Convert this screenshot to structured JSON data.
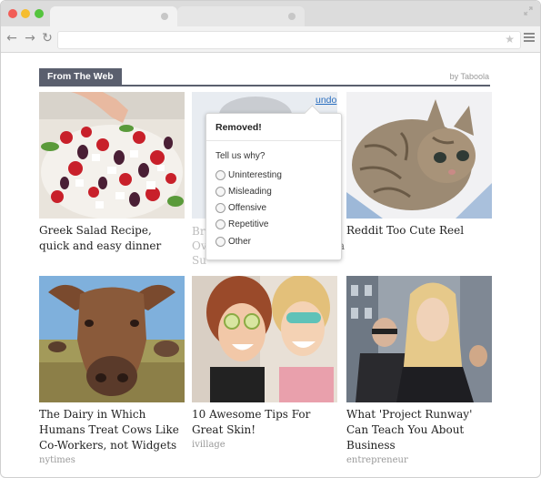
{
  "browser": {
    "url": "",
    "icons": {
      "back": "back-arrow-icon",
      "forward": "forward-arrow-icon",
      "reload": "reload-icon",
      "star": "star-icon",
      "menu": "hamburger-menu-icon",
      "expand": "expand-icon"
    }
  },
  "widget": {
    "header_label": "From The Web",
    "attribution": "by Taboola",
    "accent_color": "#5a5f6e"
  },
  "cards": [
    {
      "title": "Greek Salad Recipe, quick and easy dinner",
      "source": ""
    },
    {
      "title": "",
      "source": ""
    },
    {
      "title": "Reddit Too Cute Reel",
      "source": ""
    },
    {
      "title": "The Dairy in Which Humans Treat Cows Like Co-Workers, not Widgets",
      "source": "nytimes"
    },
    {
      "title": "10 Awesome Tips For Great Skin!",
      "source": "ivillage"
    },
    {
      "title": "What 'Project Runway' Can Teach You About Business",
      "source": "entrepreneur"
    }
  ],
  "faded_card": {
    "line1": "Br",
    "line2": "Ov",
    "line3": "Su",
    "right_fragment": "'",
    "right_fragment2": "a"
  },
  "removal_popup": {
    "undo_label": "undo",
    "title": "Removed!",
    "question": "Tell us why?",
    "reasons": [
      "Uninteresting",
      "Misleading",
      "Offensive",
      "Repetitive",
      "Other"
    ]
  }
}
